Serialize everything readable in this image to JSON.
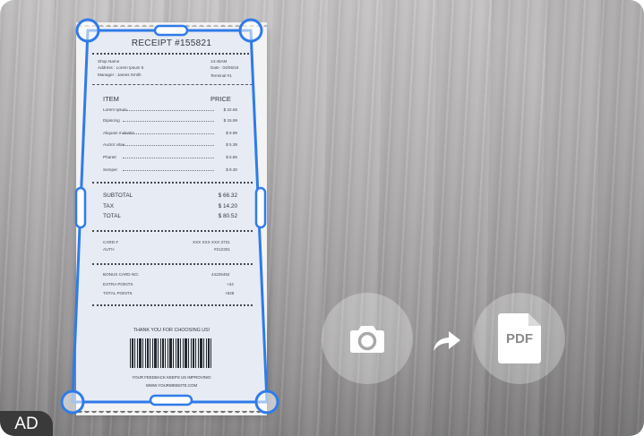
{
  "receipt": {
    "title": "RECEIPT #155821",
    "shop_name": "Shop Name",
    "address": "Address : Lorem Ipsum 5",
    "manager": "Manager : James Smith",
    "time": "14:45AM",
    "date": "Date : 04/06/16",
    "terminal": "Terminal #1",
    "col_item": "ITEM",
    "col_price": "PRICE",
    "items": [
      {
        "name": "Lorem Ipsum",
        "price": "$ 22.66"
      },
      {
        "name": "Dipiscing",
        "price": "$ 15.99"
      },
      {
        "name": "Aliquam molestie",
        "price": "$ 9.99"
      },
      {
        "name": "Auctor vitae",
        "price": "$ 5.39"
      },
      {
        "name": "Pharetr",
        "price": "$ 5.85"
      },
      {
        "name": "Semper",
        "price": "$ 8.30"
      }
    ],
    "subtotal_label": "SUBTOTAL",
    "subtotal_value": "$ 66.32",
    "tax_label": "TAX",
    "tax_value": "$ 14.20",
    "total_label": "TOTAL",
    "total_value": "$ 80.52",
    "card_label": "CARD #",
    "card_value": "XXX XXX XXX 3731",
    "auth_label": "AUTH",
    "auth_value": "#212331",
    "bonus_label": "BONUS CARD NO.",
    "bonus_value": "44225452",
    "extra_label": "EXTRA POINTS",
    "extra_value": "+34",
    "total_points_label": "TOTAL POINTS",
    "total_points_value": "+828",
    "thanks": "THANK YOU FOR CHOOSING US!",
    "feedback": "YOUR FEEDBACK KEEPS US IMPROVING!",
    "website": "WWW.YOURWEBSITE.COM"
  },
  "actions": {
    "camera_icon": "camera-icon",
    "arrow_icon": "share-arrow-icon",
    "pdf_label": "PDF"
  },
  "badge": {
    "label": "AD"
  },
  "colors": {
    "crop_outline": "#2f7bea",
    "handle_fill": "#ffffff"
  }
}
